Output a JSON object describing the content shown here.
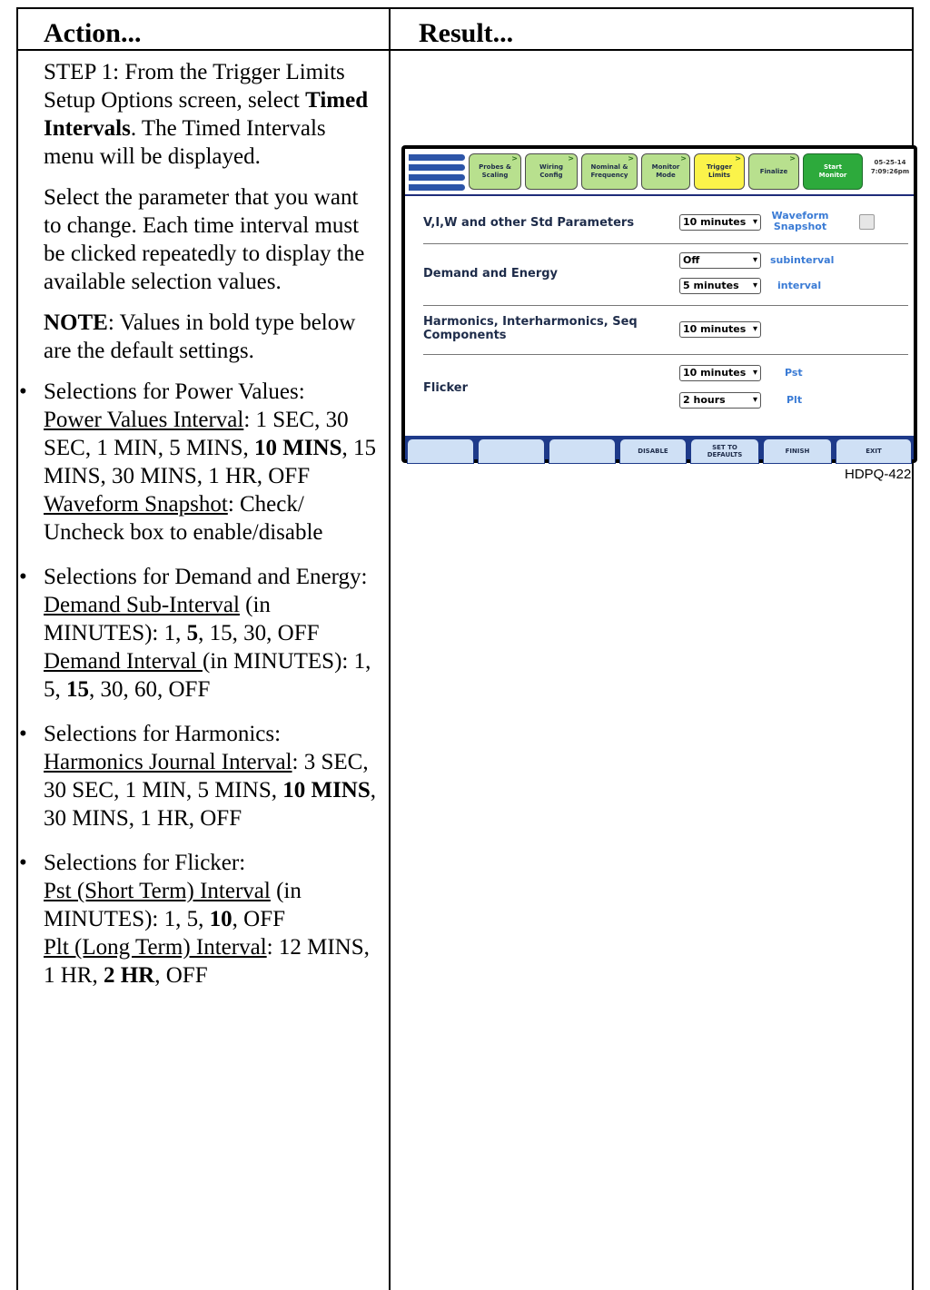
{
  "headers": {
    "action": "Action...",
    "result": "Result..."
  },
  "step1": {
    "prefix": "STEP 1: From the Trigger Limits Setup Options screen, select ",
    "bold": "Timed Intervals",
    "suffix": ". The Timed Intervals menu will be displayed."
  },
  "select_param": "Select the parameter that you want to change. Each time interval must be clicked repeatedly to display the available selection values.",
  "note": {
    "label": "NOTE",
    "text": ": Values in bold type below are the default settings."
  },
  "bullets": {
    "power": {
      "title": "Selections for Power Values:",
      "interval_label": "Power Values Interval",
      "interval_pre": ": 1 SEC, 30 SEC, 1 MIN, 5 MINS, ",
      "interval_bold": "10 MINS",
      "interval_post": ", 15 MINS, 30 MINS, 1 HR, OFF",
      "snapshot_label": "Waveform Snapshot",
      "snapshot_text": ": Check/ Uncheck box to enable/disable"
    },
    "demand": {
      "title": "Selections for Demand and Energy:",
      "sub_label": "Demand Sub-Interval",
      "sub_pre": " (in MINUTES): 1, ",
      "sub_bold": "5",
      "sub_post": ", 15, 30, OFF",
      "int_label": "Demand Interval ",
      "int_pre": "(in MINUTES): 1, 5, ",
      "int_bold": "15",
      "int_post": ", 30, 60, OFF"
    },
    "harmonics": {
      "title": "Selections for Harmonics:",
      "label": "Harmonics Journal Interval",
      "pre": ": 3 SEC, 30 SEC, 1 MIN, 5 MINS, ",
      "bold": "10 MINS",
      "post": ", 30 MINS, 1 HR, OFF"
    },
    "flicker": {
      "title": "Selections for Flicker:",
      "pst_label": "Pst (Short Term) Interval",
      "pst_pre": " (in MINUTES): 1, 5, ",
      "pst_bold": "10",
      "pst_post": ", OFF",
      "plt_label": "Plt (Long Term) Interval",
      "plt_pre": ": 12 MINS, 1 HR, ",
      "plt_bold": "2 HR",
      "plt_post": ", OFF"
    }
  },
  "screen": {
    "tabs": [
      {
        "l1": "Probes &",
        "l2": "Scaling"
      },
      {
        "l1": "Wiring",
        "l2": "Config"
      },
      {
        "l1": "Nominal &",
        "l2": "Frequency"
      },
      {
        "l1": "Monitor",
        "l2": "Mode"
      },
      {
        "l1": "Trigger",
        "l2": "Limits"
      },
      {
        "l1": "Finalize",
        "l2": ""
      },
      {
        "l1": "Start",
        "l2": "Monitor"
      }
    ],
    "date": "05-25-14",
    "time": "7:09:26pm",
    "rows": {
      "std_label": "V,I,W and other Std Parameters",
      "std_value": "10 minutes",
      "waveform_l1": "Waveform",
      "waveform_l2": "Snapshot",
      "demand_label": "Demand and Energy",
      "demand_sub_value": "Off",
      "demand_sub_tag": "subinterval",
      "demand_int_value": "5 minutes",
      "demand_int_tag": "interval",
      "harm_l1": "Harmonics, Interharmonics, Seq",
      "harm_l2": "Components",
      "harm_value": "10 minutes",
      "flicker_label": "Flicker",
      "pst_value": "10 minutes",
      "pst_tag": "Pst",
      "plt_value": "2 hours",
      "plt_tag": "Plt"
    },
    "buttons": [
      {
        "l1": "",
        "l2": ""
      },
      {
        "l1": "",
        "l2": ""
      },
      {
        "l1": "",
        "l2": ""
      },
      {
        "l1": "DISABLE",
        "l2": ""
      },
      {
        "l1": "SET TO",
        "l2": "DEFAULTS"
      },
      {
        "l1": "FINISH",
        "l2": ""
      },
      {
        "l1": "EXIT",
        "l2": ""
      }
    ]
  },
  "figure_id": "HDPQ-422",
  "colors": {
    "tab_green": "#b8e08e",
    "tab_yellow": "#fbf34a",
    "start_green": "#2daa3c",
    "accent_blue": "#3a7bd5",
    "bar_navy": "#1e3a8a"
  }
}
